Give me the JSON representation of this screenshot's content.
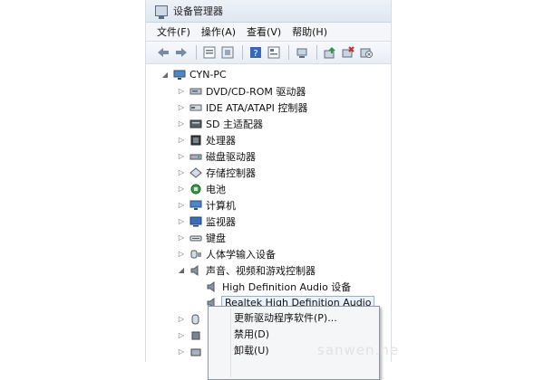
{
  "window": {
    "title": "设备管理器"
  },
  "menu": [
    "文件(F)",
    "操作(A)",
    "查看(V)",
    "帮助(H)"
  ],
  "toolbar_icons": [
    "back-arrow-icon",
    "forward-arrow-icon",
    "properties-icon",
    "show-hidden-icon",
    "help-icon",
    "view-icon",
    "scan-hardware-icon",
    "update-driver-icon",
    "disable-device-icon",
    "uninstall-device-icon"
  ],
  "tree": {
    "root": "CYN-PC",
    "items": [
      "DVD/CD-ROM 驱动器",
      "IDE ATA/ATAPI 控制器",
      "SD 主适配器",
      "处理器",
      "磁盘驱动器",
      "存储控制器",
      "电池",
      "计算机",
      "监视器",
      "键盘",
      "人体学输入设备",
      "声音、视频和游戏控制器"
    ],
    "sound_children": [
      "High Definition Audio 设备",
      "Realtek High Definition Audio"
    ]
  },
  "context_menu": [
    "更新驱动程序软件(P)...",
    "禁用(D)",
    "卸载(U)"
  ],
  "watermark": "sanwen.ne"
}
